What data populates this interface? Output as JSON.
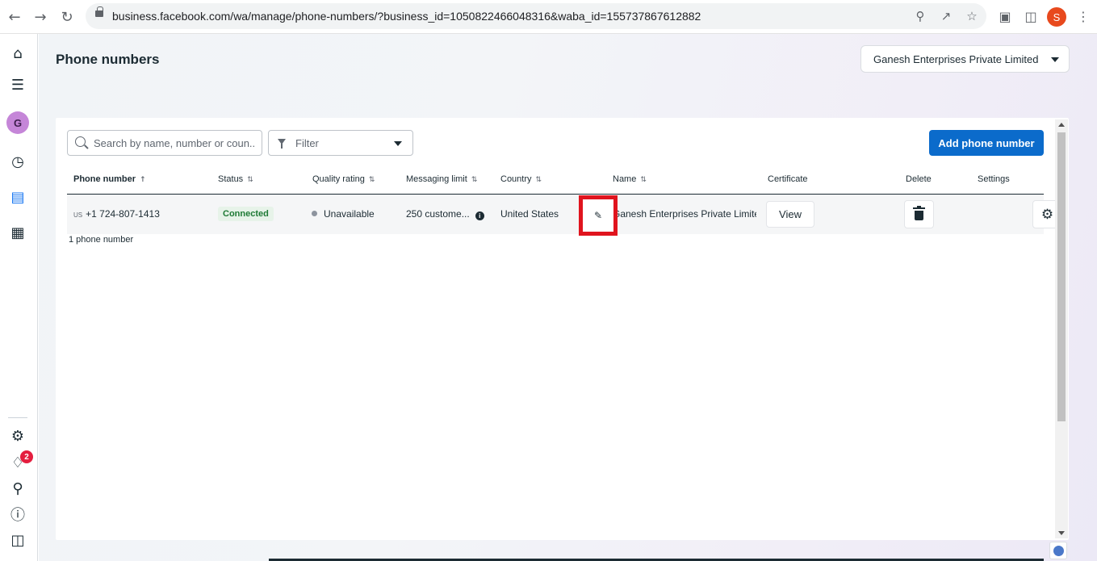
{
  "browser": {
    "url": "business.facebook.com/wa/manage/phone-numbers/?business_id=1050822466048316&waba_id=155737867612882",
    "profile_initial": "S"
  },
  "rail": {
    "account_initial": "G",
    "notifications_count": "2"
  },
  "page": {
    "title": "Phone numbers",
    "business_name": "Ganesh Enterprises Private Limited"
  },
  "toolbar": {
    "search_placeholder": "Search by name, number or coun...",
    "filter_label": "Filter",
    "add_button_label": "Add phone number"
  },
  "table": {
    "columns": {
      "phone": "Phone number",
      "status": "Status",
      "quality": "Quality rating",
      "limit": "Messaging limit",
      "country": "Country",
      "name": "Name",
      "certificate": "Certificate",
      "delete": "Delete",
      "settings": "Settings"
    },
    "rows": [
      {
        "country_code": "US",
        "phone": "+1 724-807-1413",
        "status": "Connected",
        "quality": "Unavailable",
        "limit": "250 custome...",
        "country": "United States",
        "name": "Ganesh Enterprises Private Limited",
        "certificate_button": "View"
      }
    ],
    "count_text": "1 phone number"
  },
  "colors": {
    "primary_button": "#0b6bcb",
    "status_connected": "#1e7a35",
    "highlight": "#e0141e"
  }
}
